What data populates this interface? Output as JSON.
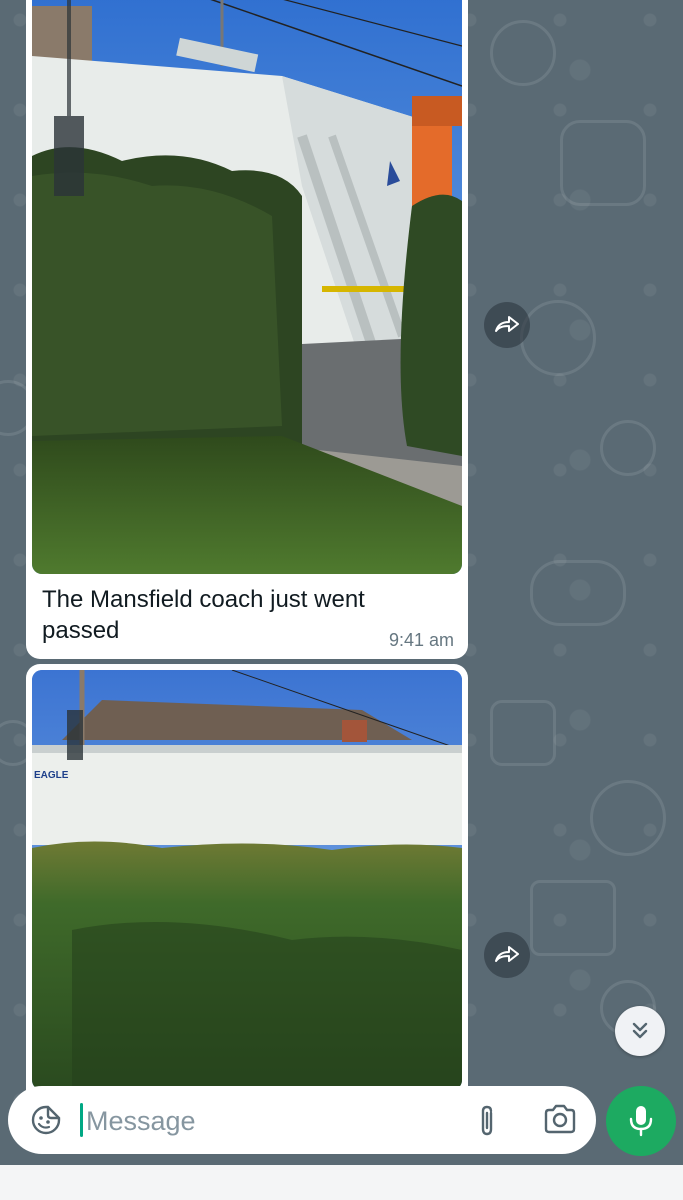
{
  "messages": [
    {
      "type": "image",
      "photo_description": "refuse-truck-behind-hedge",
      "caption": "The Mansfield coach just went passed",
      "time": "9:41 am"
    },
    {
      "type": "image",
      "photo_description": "hedge-in-front-of-white-vehicle",
      "photo_text": "EAGLE"
    }
  ],
  "composer": {
    "placeholder": "Message"
  },
  "icons": {
    "emoji": "sticker-icon",
    "attach": "paperclip-icon",
    "camera": "camera-icon",
    "mic": "microphone-icon",
    "forward": "forward-icon",
    "scroll_down": "double-chevron-down-icon"
  },
  "colors": {
    "accent": "#1daa61",
    "caret": "#00a884",
    "chat_background": "#5a6a74",
    "bubble": "#ffffff"
  }
}
